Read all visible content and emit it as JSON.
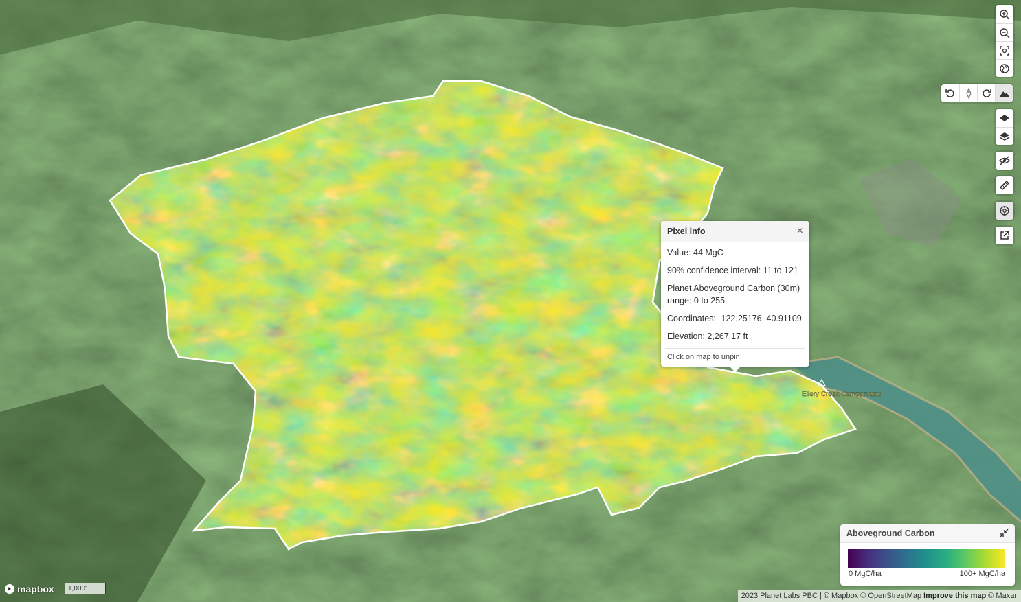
{
  "map": {
    "place_label": "Ellery Creek Campground"
  },
  "popup": {
    "title": "Pixel info",
    "close_glyph": "×",
    "value": "Value: 44 MgC",
    "confidence": "90% confidence interval: 11 to 121",
    "product": "Planet Aboveground Carbon (30m) range: 0 to 255",
    "coordinates": "Coordinates: -122.25176, 40.91109",
    "elevation": "Elevation: 2,267.17 ft",
    "footer": "Click on map to unpin"
  },
  "legend": {
    "title": "Aboveground Carbon",
    "min_label": "0 MgC/ha",
    "max_label": "100+ MgC/ha",
    "colors": [
      "#440154",
      "#3b528b",
      "#21918c",
      "#5ec962",
      "#fde725"
    ]
  },
  "controls": {
    "zoom": [
      "zoom-in-icon",
      "zoom-out-icon",
      "fit-bounds-icon",
      "globe-icon"
    ],
    "rotate": [
      "rotate-left-icon",
      "compass-icon",
      "rotate-right-icon",
      "terrain-icon"
    ],
    "layers": [
      "layer-icon",
      "layers-stack-icon"
    ],
    "tools": [
      "hide-icon",
      "ruler-icon",
      "target-icon",
      "external-link-icon"
    ]
  },
  "scale_text": "1,000'",
  "logo_text": "mapbox",
  "attribution": {
    "text": "2023 Planet Labs PBC | © Mapbox © OpenStreetMap",
    "improve": "Improve this map",
    "maxar": "© Maxar"
  }
}
